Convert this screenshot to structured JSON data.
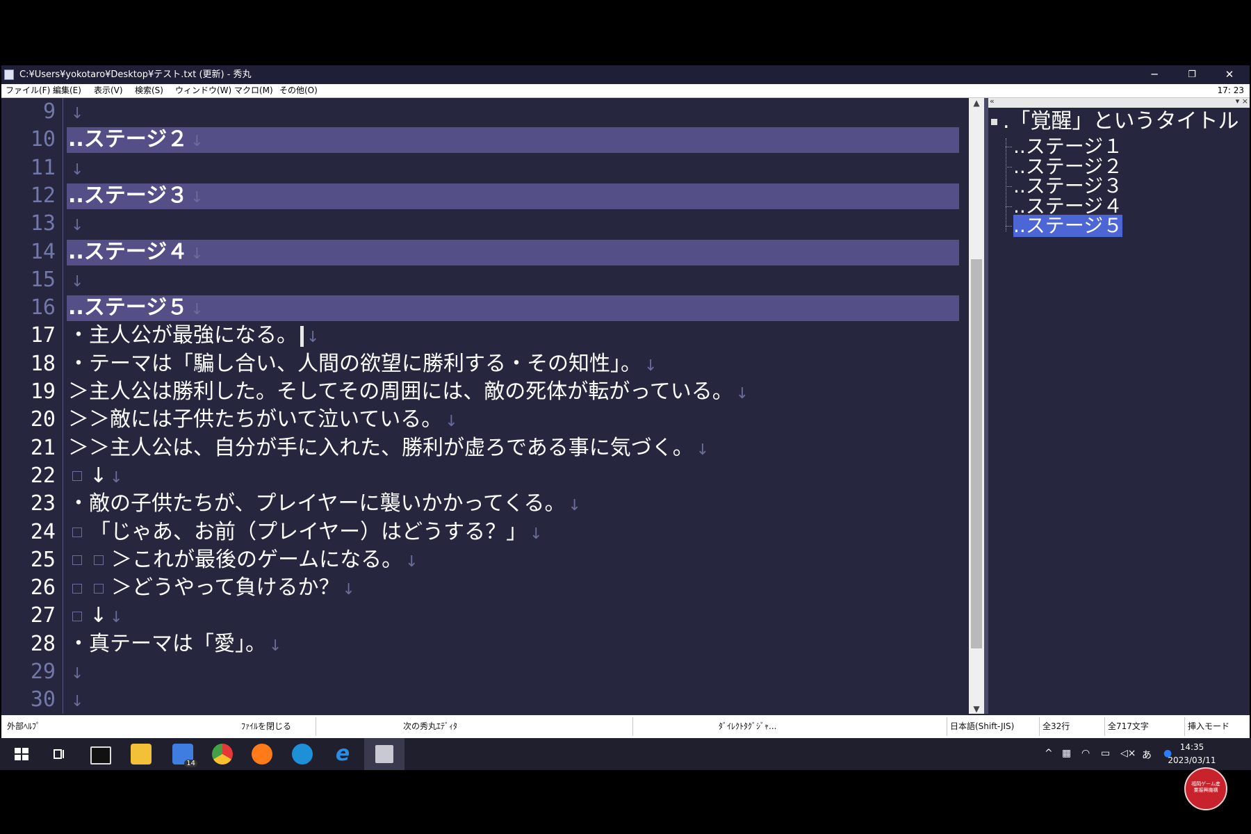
{
  "window": {
    "title": "C:¥Users¥yokotaro¥Desktop¥テスト.txt (更新) - 秀丸",
    "minimize": "─",
    "maximize": "❐",
    "close": "✕"
  },
  "menu": {
    "items": [
      "ファイル(F)",
      "編集(E)",
      "表示(V)",
      "検索(S)",
      "ウィンドウ(W)",
      "マクロ(M)",
      "その他(O)"
    ],
    "clock": "17: 23"
  },
  "editor": {
    "lines": [
      {
        "num": "9",
        "text": "",
        "highlight": false
      },
      {
        "num": "10",
        "text": "..ステージ２",
        "highlight": true
      },
      {
        "num": "11",
        "text": "",
        "highlight": false
      },
      {
        "num": "12",
        "text": "..ステージ３",
        "highlight": true
      },
      {
        "num": "13",
        "text": "",
        "highlight": false
      },
      {
        "num": "14",
        "text": "..ステージ４",
        "highlight": true
      },
      {
        "num": "15",
        "text": "",
        "highlight": false
      },
      {
        "num": "16",
        "text": "..ステージ５",
        "highlight": true
      },
      {
        "num": "17",
        "text": "・主人公が最強になる。",
        "highlight": false,
        "caret": true
      },
      {
        "num": "18",
        "text": "・テーマは「騙し合い、人間の欲望に勝利する・その知性」。",
        "highlight": false
      },
      {
        "num": "19",
        "text": "＞主人公は勝利した。そしてその周囲には、敵の死体が転がっている。",
        "highlight": false
      },
      {
        "num": "20",
        "text": "＞＞敵には子供たちがいて泣いている。",
        "highlight": false
      },
      {
        "num": "21",
        "text": "＞＞主人公は、自分が手に入れた、勝利が虚ろである事に気づく。",
        "highlight": false
      },
      {
        "num": "22",
        "text": "↓",
        "indent": 1,
        "highlight": false
      },
      {
        "num": "23",
        "text": "・敵の子供たちが、プレイヤーに襲いかかってくる。",
        "highlight": false
      },
      {
        "num": "24",
        "text": "「じゃあ、お前（プレイヤー）はどうする？」",
        "indent": 1,
        "highlight": false
      },
      {
        "num": "25",
        "text": "＞これが最後のゲームになる。",
        "indent": 2,
        "highlight": false
      },
      {
        "num": "26",
        "text": "＞どうやって負けるか？",
        "indent": 2,
        "highlight": false
      },
      {
        "num": "27",
        "text": "↓",
        "indent": 1,
        "highlight": false
      },
      {
        "num": "28",
        "text": "・真テーマは「愛」。",
        "highlight": false
      },
      {
        "num": "29",
        "text": "",
        "highlight": false
      },
      {
        "num": "30",
        "text": "",
        "highlight": false
      }
    ],
    "eol_mark": "↓"
  },
  "outline": {
    "collapse_left": "«",
    "collapse_right": "▾ ×",
    "root": ".「覚醒」というタイトル",
    "items": [
      "..ステージ１",
      "..ステージ２",
      "..ステージ３",
      "..ステージ４",
      "..ステージ５"
    ],
    "selected_index": 4
  },
  "statusbar": {
    "help": "外部ﾍﾙﾌﾟ",
    "close_file": "ﾌｧｲﾙを閉じる",
    "next_editor": "次の秀丸ｴﾃﾞｨﾀ",
    "direct_tag": "ﾀﾞｲﾚｸﾄﾀｸﾞｼﾞｬ...",
    "encoding": "日本語(Shift-JIS)",
    "lines": "全32行",
    "chars": "全717文字",
    "mode": "挿入モード"
  },
  "taskbar": {
    "badge": "14",
    "ime": "あ",
    "time": "14:35",
    "date": "2023/03/11",
    "colors": {
      "edge": "#1e90d8",
      "ie": "#2b8ee6",
      "chrome": "#e53935",
      "firefox": "#ff7a18",
      "explorer": "#f3c137",
      "mail": "#3f7de0"
    }
  },
  "logo_text": "福岡ゲーム産業振興機構"
}
